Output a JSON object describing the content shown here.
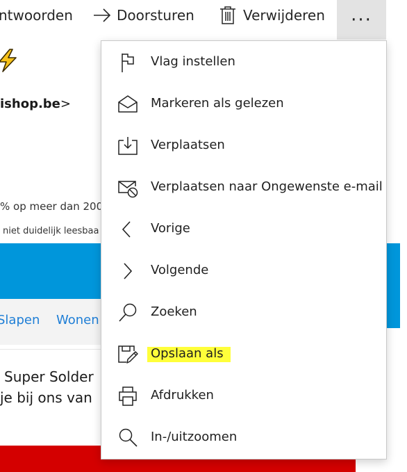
{
  "toolbar": {
    "reply_label": "ntwoorden",
    "forward_label": "Doorsturen",
    "delete_label": "Verwijderen",
    "more_label": "···",
    "forward_icon": "arrow-right-icon",
    "delete_icon": "trash-icon"
  },
  "email": {
    "emoji_icon": "lightning-bolt-icon",
    "sender": "ishop.be",
    "sender_suffix": ">",
    "promo_line": "% op meer dan 200",
    "readable_line": "niet duidelijk leesbaa",
    "nav_items": [
      "Slapen",
      "Wonen"
    ],
    "promo_text_1": "Super Solder",
    "promo_text_2": "je bij ons van"
  },
  "menu": {
    "items": [
      {
        "label": "Vlag instellen",
        "icon": "flag-icon"
      },
      {
        "label": "Markeren als gelezen",
        "icon": "open-envelope-icon"
      },
      {
        "label": "Verplaatsen",
        "icon": "move-to-folder-icon"
      },
      {
        "label": "Verplaatsen naar Ongewenste e-mail",
        "icon": "junk-mail-icon"
      },
      {
        "label": "Vorige",
        "icon": "chevron-left-icon"
      },
      {
        "label": "Volgende",
        "icon": "chevron-right-icon"
      },
      {
        "label": "Zoeken",
        "icon": "search-icon"
      },
      {
        "label": "Opslaan als",
        "icon": "save-as-icon",
        "highlighted": true
      },
      {
        "label": "Afdrukken",
        "icon": "printer-icon"
      },
      {
        "label": "In-/uitzoomen",
        "icon": "zoom-icon"
      }
    ]
  },
  "colors": {
    "highlight": "#ffff3a",
    "blue_band": "#0096db",
    "red_band": "#d40000",
    "link": "#1e7ed6"
  }
}
